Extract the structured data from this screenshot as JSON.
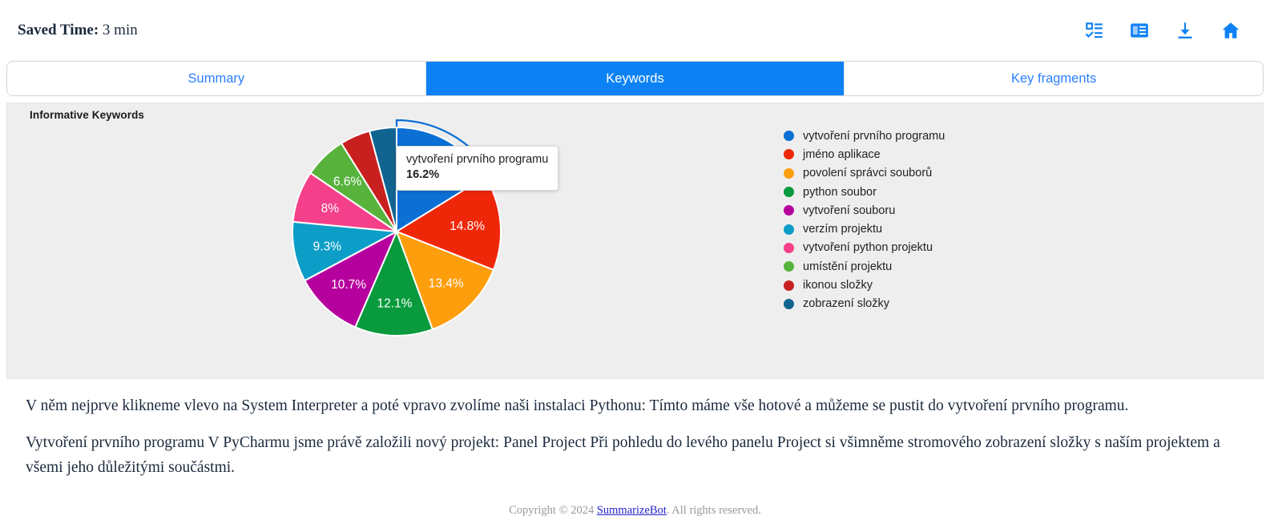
{
  "header": {
    "saved_time_label": "Saved Time:",
    "saved_time_value": "3 min",
    "icons": [
      {
        "name": "fact-check-icon",
        "title": "Fact check"
      },
      {
        "name": "article-icon",
        "title": "Article"
      },
      {
        "name": "download-icon",
        "title": "Download"
      },
      {
        "name": "home-icon",
        "title": "Home"
      }
    ]
  },
  "tabs": [
    {
      "label": "Summary",
      "active": false
    },
    {
      "label": "Keywords",
      "active": true
    },
    {
      "label": "Key fragments",
      "active": false
    }
  ],
  "chart_panel": {
    "title": "Informative Keywords",
    "tooltip": {
      "name": "vytvoření prvního programu",
      "value": "16.2%"
    }
  },
  "chart_data": {
    "type": "pie",
    "title": "Informative Keywords",
    "legend_position": "right",
    "categories": [
      "vytvoření prvního programu",
      "jméno aplikace",
      "povolení správci souborů",
      "python soubor",
      "vytvoření souboru",
      "verzím projektu",
      "vytvoření python projektu",
      "umístění projektu",
      "ikonou složky",
      "zobrazení složky"
    ],
    "values": [
      16.2,
      14.8,
      13.4,
      12.1,
      10.7,
      9.3,
      8,
      6.6,
      4.7,
      4.2
    ],
    "labels": [
      "16.2%",
      "14.8%",
      "13.4%",
      "12.1%",
      "10.7%",
      "9.3%",
      "8%",
      "6.6%",
      "",
      ""
    ],
    "colors": [
      "#0b6fd4",
      "#ef2709",
      "#fe9e0d",
      "#089a3d",
      "#b6009e",
      "#0d9ec7",
      "#f4408a",
      "#57b33c",
      "#c81f1f",
      "#116490"
    ],
    "highlighted_index": 0
  },
  "body": {
    "paragraphs": [
      "V něm nejprve klikneme vlevo na System Interpreter a poté vpravo zvolíme naši instalaci Pythonu: Tímto máme vše hotové a můžeme se pustit do vytvoření prvního programu.",
      "Vytvoření prvního programu V PyCharmu jsme právě založili nový projekt: Panel Project Při pohledu do levého panelu Project si všimněme stromového zobrazení složky s naším projektem a všemi jeho důležitými součástmi."
    ]
  },
  "footer": {
    "prefix": "Copyright © 2024 ",
    "link": "SummarizeBot",
    "suffix": ". All rights reserved."
  },
  "colors": {
    "accent": "#0d82f5",
    "tab_text": "#2b7fff",
    "panel_bg": "#eeeeee",
    "text": "#1b2a3d"
  }
}
